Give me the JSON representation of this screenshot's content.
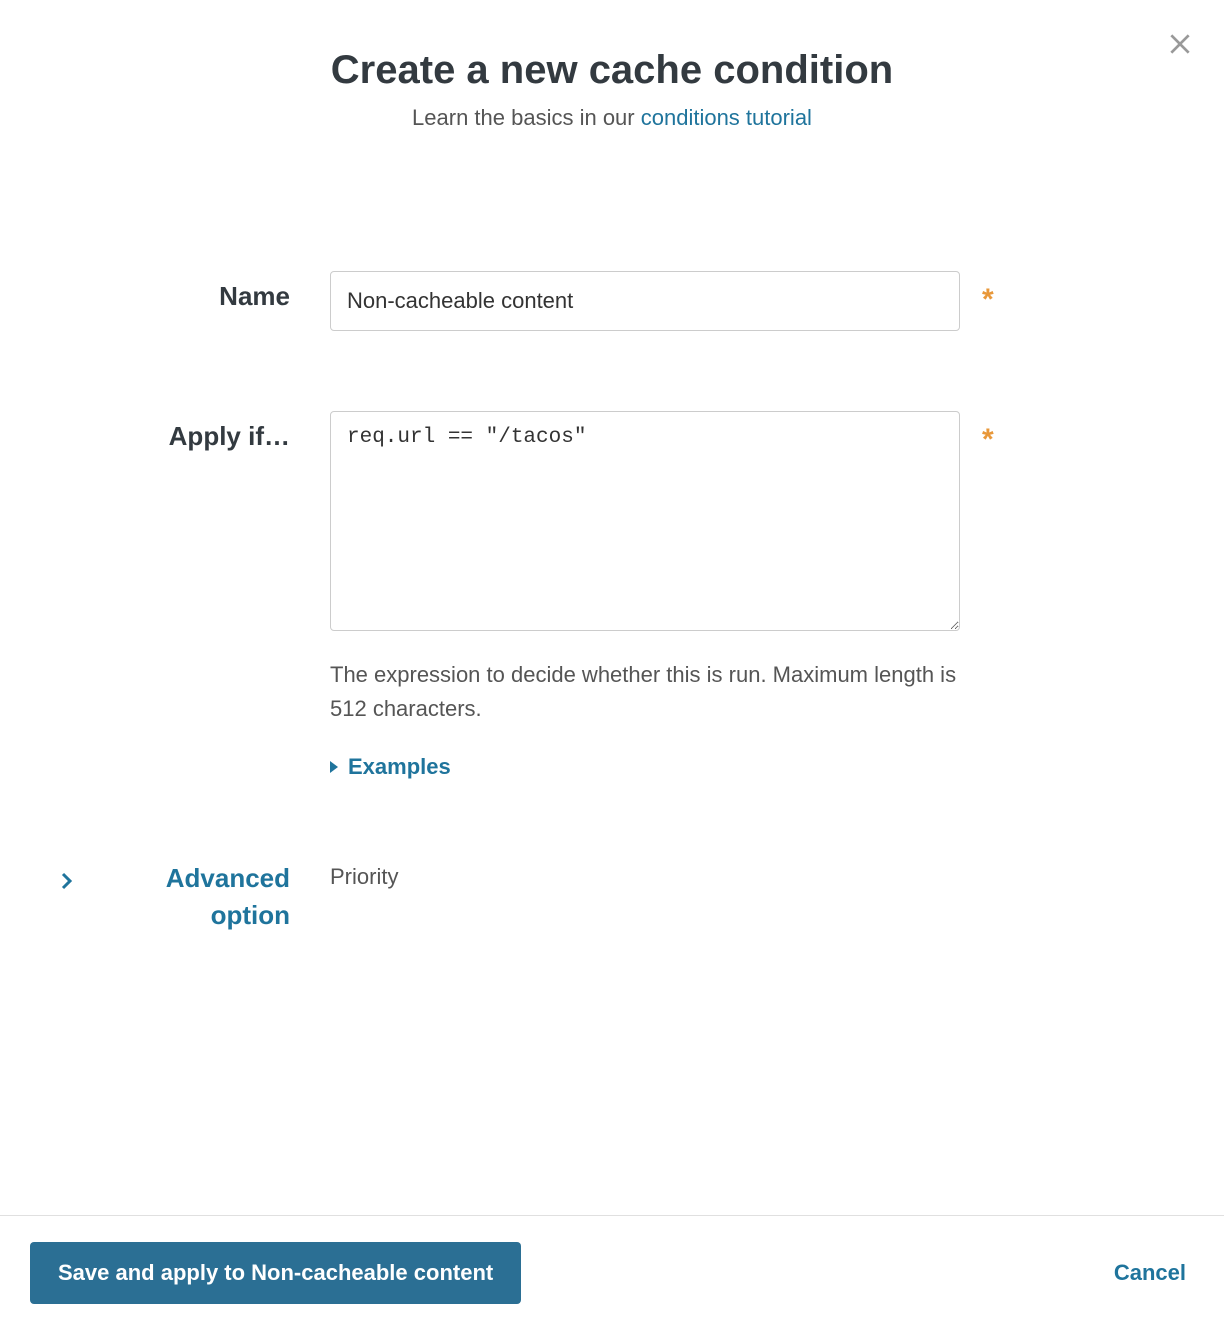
{
  "header": {
    "title": "Create a new cache condition",
    "subtitle_prefix": "Learn the basics in our ",
    "subtitle_link": "conditions tutorial"
  },
  "form": {
    "name": {
      "label": "Name",
      "value": "Non-cacheable content",
      "required_marker": "*"
    },
    "apply_if": {
      "label": "Apply if…",
      "value": "req.url == \"/tacos\"",
      "required_marker": "*",
      "help": "The expression to decide whether this is run. Maximum length is 512 characters.",
      "examples_label": "Examples"
    },
    "advanced": {
      "toggle_label": "Advanced option",
      "priority_label": "Priority"
    }
  },
  "footer": {
    "save_label": "Save and apply to Non-cacheable content",
    "cancel_label": "Cancel"
  }
}
